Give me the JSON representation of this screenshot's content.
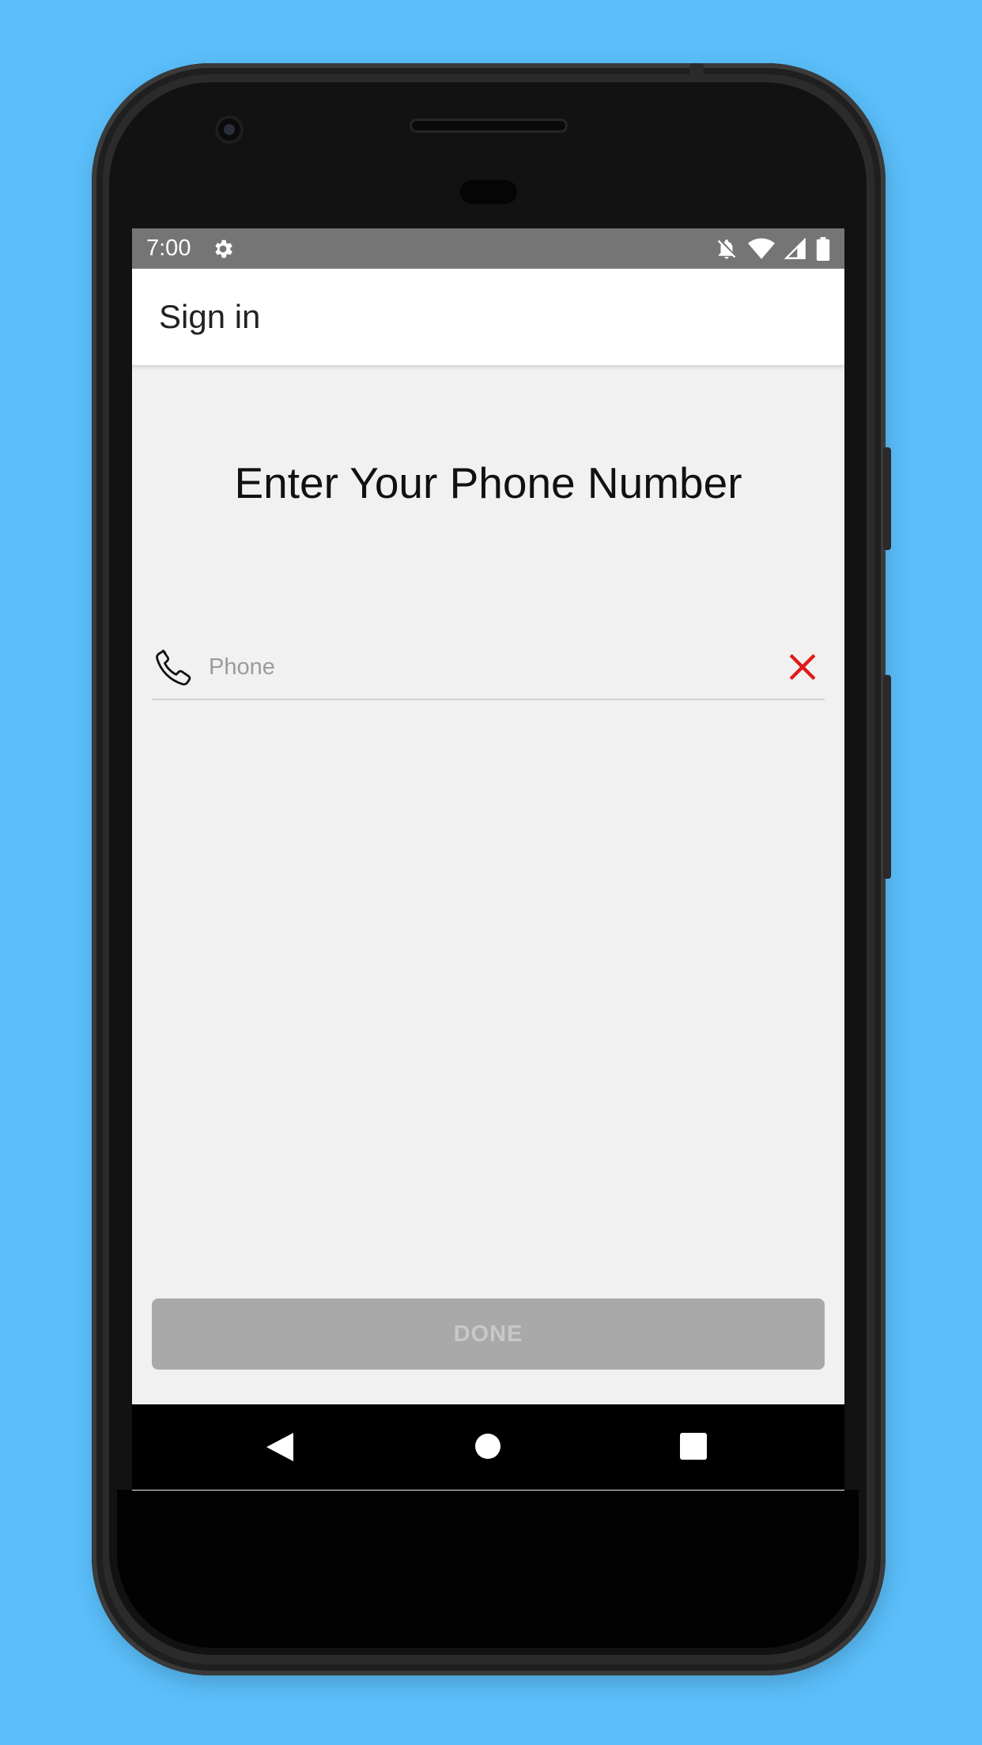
{
  "status_bar": {
    "time": "7:00",
    "icons": [
      "settings-gear-icon",
      "alarm-off-icon",
      "wifi-icon",
      "signal-icon",
      "battery-icon"
    ]
  },
  "app_bar": {
    "title": "Sign in"
  },
  "main": {
    "heading": "Enter Your Phone Number",
    "phone_input": {
      "placeholder": "Phone",
      "value": ""
    },
    "done_label": "DONE"
  },
  "nav_bar": {
    "buttons": [
      "back",
      "home",
      "recents"
    ]
  },
  "colors": {
    "background": "#5bbffb",
    "status_bar": "#757575",
    "clear_icon": "#e0191b",
    "done_disabled": "#a9a9a9"
  }
}
